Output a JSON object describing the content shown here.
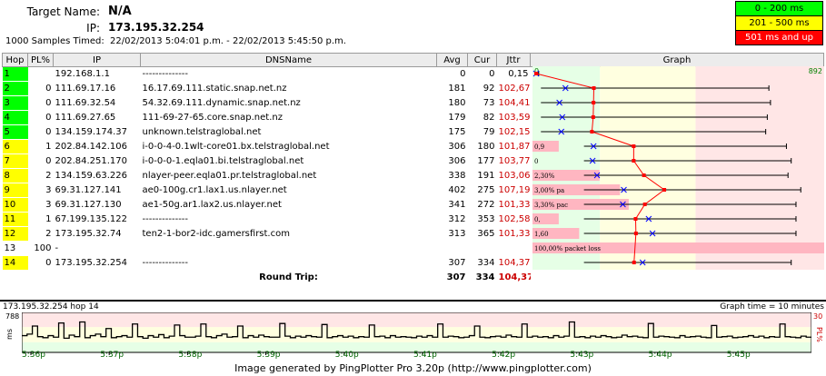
{
  "header": {
    "target_label": "Target Name:",
    "target_value": "N/A",
    "ip_label": "IP:",
    "ip_value": "173.195.32.254",
    "samples_label": "1000 Samples Timed:",
    "samples_value": "22/02/2013 5:04:01 p.m. - 22/02/2013 5:45:50 p.m."
  },
  "legend": [
    {
      "label": "0 - 200 ms",
      "color": "#00ff00",
      "text_color": "#000000"
    },
    {
      "label": "201 - 500 ms",
      "color": "#ffff00",
      "text_color": "#000000"
    },
    {
      "label": "501 ms and up",
      "color": "#ff0000",
      "text_color": "#ffffff"
    }
  ],
  "columns": [
    "Hop",
    "PL%",
    "IP",
    "DNSName",
    "Avg",
    "Cur",
    "Jttr",
    "Graph"
  ],
  "graph_scale": {
    "min_label": "0",
    "max_label": "892",
    "max_ms": 892
  },
  "hops": [
    {
      "hop": "1",
      "pl": "",
      "ip": "192.168.1.1",
      "dns": "--------------",
      "avg": "0",
      "cur": "0",
      "jttr": "0,15",
      "status": "green",
      "pl_note": "",
      "avg_ms": 0,
      "min_ms": 0,
      "max_ms": 8,
      "cur_ms": 0,
      "pl_width_pct": 0
    },
    {
      "hop": "2",
      "pl": "0",
      "ip": "111.69.17.16",
      "dns": "16.17.69.111.static.snap.net.nz",
      "avg": "181",
      "cur": "92",
      "jttr": "102,67",
      "status": "green",
      "pl_note": "",
      "avg_ms": 181,
      "min_ms": 15,
      "max_ms": 730,
      "cur_ms": 92,
      "pl_width_pct": 0
    },
    {
      "hop": "3",
      "pl": "0",
      "ip": "111.69.32.54",
      "dns": "54.32.69.111.dynamic.snap.net.nz",
      "avg": "180",
      "cur": "73",
      "jttr": "104,41",
      "status": "green",
      "pl_note": "",
      "avg_ms": 180,
      "min_ms": 15,
      "max_ms": 735,
      "cur_ms": 73,
      "pl_width_pct": 0
    },
    {
      "hop": "4",
      "pl": "0",
      "ip": "111.69.27.65",
      "dns": "111-69-27-65.core.snap.net.nz",
      "avg": "179",
      "cur": "82",
      "jttr": "103,59",
      "status": "green",
      "pl_note": "",
      "avg_ms": 179,
      "min_ms": 15,
      "max_ms": 725,
      "cur_ms": 82,
      "pl_width_pct": 0
    },
    {
      "hop": "5",
      "pl": "0",
      "ip": "134.159.174.37",
      "dns": "unknown.telstraglobal.net",
      "avg": "175",
      "cur": "79",
      "jttr": "102,15",
      "status": "green",
      "pl_note": "",
      "avg_ms": 175,
      "min_ms": 15,
      "max_ms": 720,
      "cur_ms": 79,
      "pl_width_pct": 0
    },
    {
      "hop": "6",
      "pl": "1",
      "ip": "202.84.142.106",
      "dns": "i-0-0-4-0.1wlt-core01.bx.telstraglobal.net",
      "avg": "306",
      "cur": "180",
      "jttr": "101,87",
      "status": "yellow",
      "pl_note": "0,9",
      "avg_ms": 306,
      "min_ms": 150,
      "max_ms": 785,
      "cur_ms": 180,
      "pl_width_pct": 0.9
    },
    {
      "hop": "7",
      "pl": "0",
      "ip": "202.84.251.170",
      "dns": "i-0-0-0-1.eqla01.bi.telstraglobal.net",
      "avg": "306",
      "cur": "177",
      "jttr": "103,77",
      "status": "yellow",
      "pl_note": "0",
      "avg_ms": 306,
      "min_ms": 150,
      "max_ms": 800,
      "cur_ms": 177,
      "pl_width_pct": 0
    },
    {
      "hop": "8",
      "pl": "2",
      "ip": "134.159.63.226",
      "dns": "nlayer-peer.eqla01.pr.telstraglobal.net",
      "avg": "338",
      "cur": "191",
      "jttr": "103,06",
      "status": "yellow",
      "pl_note": "2,30%",
      "avg_ms": 338,
      "min_ms": 150,
      "max_ms": 790,
      "cur_ms": 191,
      "pl_width_pct": 2.3
    },
    {
      "hop": "9",
      "pl": "3",
      "ip": "69.31.127.141",
      "dns": "ae0-100g.cr1.lax1.us.nlayer.net",
      "avg": "402",
      "cur": "275",
      "jttr": "107,19",
      "status": "yellow",
      "pl_note": "3,00% pa",
      "avg_ms": 402,
      "min_ms": 150,
      "max_ms": 830,
      "cur_ms": 275,
      "pl_width_pct": 3.0
    },
    {
      "hop": "10",
      "pl": "3",
      "ip": "69.31.127.130",
      "dns": "ae1-50g.ar1.lax2.us.nlayer.net",
      "avg": "341",
      "cur": "272",
      "jttr": "101,33",
      "status": "yellow",
      "pl_note": "3,30% pac",
      "avg_ms": 341,
      "min_ms": 150,
      "max_ms": 815,
      "cur_ms": 272,
      "pl_width_pct": 3.3
    },
    {
      "hop": "11",
      "pl": "1",
      "ip": "67.199.135.122",
      "dns": "--------------",
      "avg": "312",
      "cur": "353",
      "jttr": "102,58",
      "status": "yellow",
      "pl_note": "0,",
      "avg_ms": 312,
      "min_ms": 150,
      "max_ms": 815,
      "cur_ms": 353,
      "pl_width_pct": 0.9
    },
    {
      "hop": "12",
      "pl": "2",
      "ip": "173.195.32.74",
      "dns": "ten2-1-bor2-idc.gamersfirst.com",
      "avg": "313",
      "cur": "365",
      "jttr": "101,33",
      "status": "yellow",
      "pl_note": "1,60",
      "avg_ms": 313,
      "min_ms": 150,
      "max_ms": 815,
      "cur_ms": 365,
      "pl_width_pct": 1.6
    },
    {
      "hop": "13",
      "pl": "100",
      "ip": "-",
      "dns": "",
      "avg": "",
      "cur": "",
      "jttr": "",
      "status": "white",
      "pl_note": "100,00% packet loss",
      "avg_ms": null,
      "min_ms": null,
      "max_ms": null,
      "cur_ms": null,
      "pl_width_pct": 100
    },
    {
      "hop": "14",
      "pl": "0",
      "ip": "173.195.32.254",
      "dns": "--------------",
      "avg": "307",
      "cur": "334",
      "jttr": "104,37",
      "status": "yellow",
      "pl_note": "",
      "avg_ms": 307,
      "min_ms": 150,
      "max_ms": 800,
      "cur_ms": 334,
      "pl_width_pct": 0
    }
  ],
  "round_trip": {
    "label": "Round Trip:",
    "avg": "307",
    "cur": "334",
    "jttr": "104,37"
  },
  "bottom_chart": {
    "title": "173.195.32.254 hop 14",
    "graph_time": "Graph time = 10 minutes",
    "y_max_label": "788",
    "y_unit": "ms",
    "y_right_top": "30",
    "y_right_label": "PL%",
    "x_ticks": [
      "5:36p",
      "5:37p",
      "5:38p",
      "5:39p",
      "5:40p",
      "5:41p",
      "5:42p",
      "5:43p",
      "5:44p",
      "5:45p"
    ],
    "series_ms": [
      330,
      360,
      520,
      310,
      290,
      330,
      300,
      580,
      280,
      340,
      310,
      600,
      290,
      330,
      360,
      310,
      470,
      290,
      310,
      330,
      300,
      560,
      310,
      280,
      330,
      300,
      350,
      290,
      320,
      540,
      330,
      300,
      300,
      320,
      560,
      310,
      290,
      330,
      360,
      300,
      310,
      520,
      290,
      330,
      300,
      340,
      310,
      300,
      300,
      570,
      320,
      290,
      320,
      300,
      330,
      310,
      300,
      550,
      290,
      310,
      330,
      300,
      320,
      290,
      310,
      300,
      540,
      310,
      320,
      290,
      330,
      300,
      310,
      300,
      290,
      320,
      300,
      330,
      300,
      560,
      300,
      320,
      310,
      290,
      300,
      330,
      520,
      300,
      290,
      310,
      320,
      300,
      340,
      310,
      300,
      560,
      300,
      320,
      300,
      310,
      290,
      330,
      300,
      320,
      600,
      300,
      310,
      290,
      320,
      300,
      330,
      310,
      290,
      300,
      340,
      310,
      320,
      300,
      290,
      570,
      300,
      320,
      310,
      300,
      290,
      330,
      300,
      310,
      320,
      300,
      290,
      530,
      300,
      310,
      320,
      290,
      300,
      310,
      330,
      300,
      320,
      290,
      310,
      300,
      560,
      310,
      300,
      290,
      320,
      300
    ]
  },
  "footer": "Image generated by PingPlotter Pro 3.20p (http://www.pingplotter.com)"
}
